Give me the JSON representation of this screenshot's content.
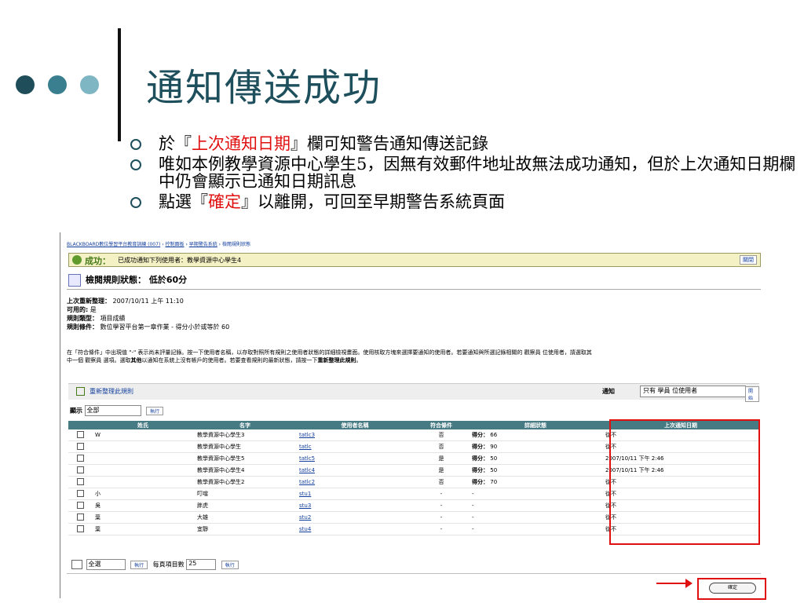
{
  "slide": {
    "title": "通知傳送成功",
    "bullets": [
      {
        "pre": "於『",
        "hl": "上次通知日期",
        "post": "』欄可知警告通知傳送記錄"
      },
      {
        "pre": "唯如本例教學資源中心學生5，因無有效郵件地址故無法成功通知，但於上次通知日期欄中仍會顯示已通知日期訊息",
        "hl": "",
        "post": ""
      },
      {
        "pre": "點選『",
        "hl": "確定",
        "post": "』以離開，可回至早期警告系統頁面"
      }
    ]
  },
  "screen": {
    "breadcrumb": [
      "BLACKBOARD數位學習平台教育訓練 (007)",
      "控制面板",
      "早期警告系統",
      "檢閱規則狀態"
    ],
    "success_label": "成功：",
    "success_message": "已成功通知下列使用者：教學資源中心學生4",
    "close_label": "關閉",
    "rule_title": "檢閱規則狀態： 低於60分",
    "meta": [
      {
        "k": "上次重新整理：",
        "v": "2007/10/11 上午 11:10"
      },
      {
        "k": "可用的:",
        "v": "是"
      },
      {
        "k": "規則類型：",
        "v": "項目成績"
      },
      {
        "k": "規則條件：",
        "v": "數位學習平台第一章作業 - 得分小於或等於 60"
      }
    ],
    "description_1": "在「符合條件」中出現值 \"-\" 表示尚未評量記錄。按一下使用者名稱，以存取對照所有規則之使用者狀態的詳細檢視畫面。使用核取方塊來選擇要通知的使用者。若要通知與所選記錄相關的 觀察員 位使用者，請選取其",
    "description_2": "中一個 觀察員 選項。選取",
    "description_bold": "其他",
    "description_3": "以通知在系統上沒有帳戶的使用者。若要查看規則的最新狀態，請按一下",
    "description_bold2": "重新整理此規則",
    "description_4": "。",
    "refresh_label": "重新整理此規則",
    "notify_label": "通知",
    "notify_select": "只有 學員 位使用者",
    "go_label": "開始",
    "show_label": "顯示",
    "show_select": "全部",
    "run_label": "執行",
    "columns": [
      "姓氏",
      "名字",
      "使用者名稱",
      "符合條件",
      "詳細狀態",
      "上次通知日期"
    ],
    "rows": [
      {
        "last": "W",
        "first": "教學資源中心學生3",
        "user": "tatlc3",
        "match": "否",
        "detail": "66",
        "notified": "從不"
      },
      {
        "last": "",
        "first": "教學資源中心學生",
        "user": "tatlc",
        "match": "否",
        "detail": "90",
        "notified": "從不"
      },
      {
        "last": "",
        "first": "教學資源中心學生5",
        "user": "tatlc5",
        "match": "是",
        "detail": "50",
        "notified": "2007/10/11 下午 2:46"
      },
      {
        "last": "",
        "first": "教學資源中心學生4",
        "user": "tatlc4",
        "match": "是",
        "detail": "50",
        "notified": "2007/10/11 下午 2:46"
      },
      {
        "last": "",
        "first": "教學資源中心學生2",
        "user": "tatlc2",
        "match": "否",
        "detail": "70",
        "notified": "從不"
      },
      {
        "last": "小",
        "first": "叮噹",
        "user": "stu1",
        "match": "-",
        "detail": "",
        "notified": "從不"
      },
      {
        "last": "吳",
        "first": "胖虎",
        "user": "stu3",
        "match": "-",
        "detail": "",
        "notified": "從不"
      },
      {
        "last": "葉",
        "first": "大雄",
        "user": "stu2",
        "match": "-",
        "detail": "",
        "notified": "從不"
      },
      {
        "last": "葉",
        "first": "宜靜",
        "user": "stu4",
        "match": "-",
        "detail": "",
        "notified": "從不"
      }
    ],
    "score_label": "得分：",
    "bottom_select": "全選",
    "per_page_label": "每頁項目數",
    "per_page_value": "25",
    "ok_label": "確定"
  }
}
